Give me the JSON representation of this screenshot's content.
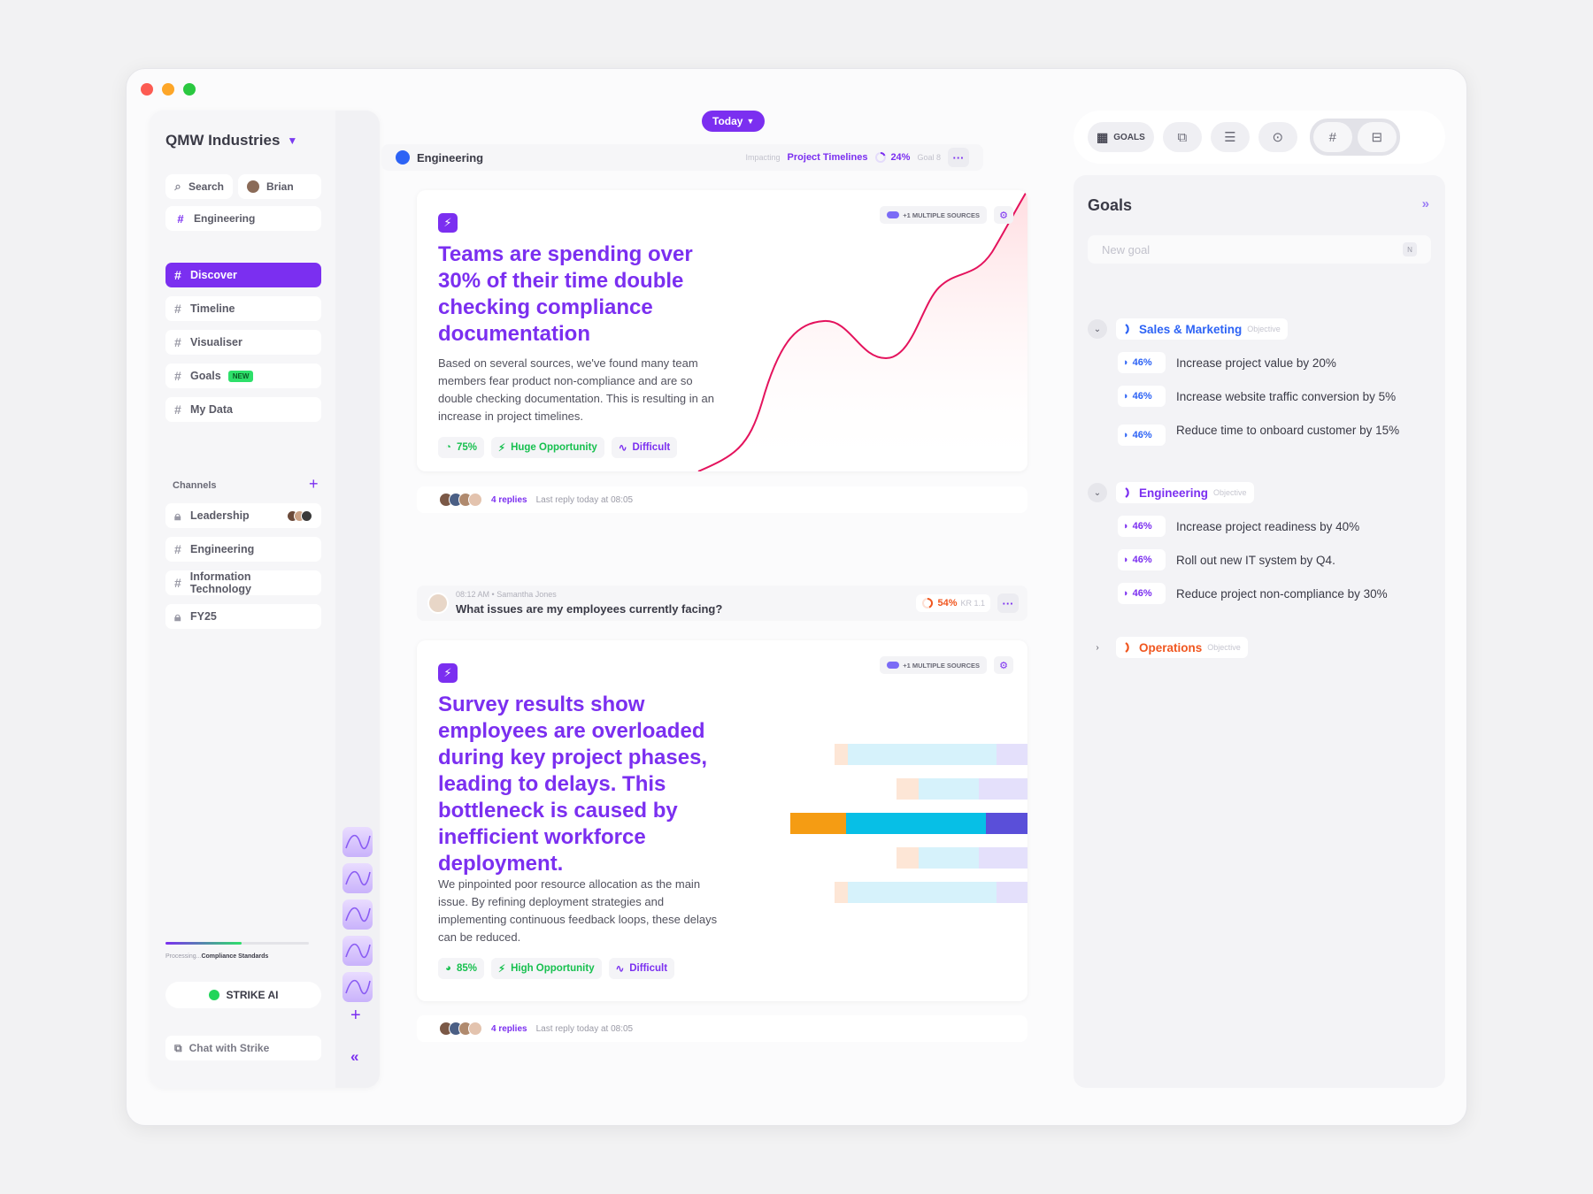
{
  "window": {
    "controls": [
      "close",
      "minimize",
      "maximize"
    ]
  },
  "sidebar": {
    "workspace": "QMW Industries",
    "search_label": "Search",
    "user_label": "Brian",
    "context_label": "Engineering",
    "nav": [
      {
        "label": "Discover",
        "active": true
      },
      {
        "label": "Timeline"
      },
      {
        "label": "Visualiser"
      },
      {
        "label": "Goals",
        "badge": "NEW"
      },
      {
        "label": "My Data"
      }
    ],
    "channels_heading": "Channels",
    "channels": [
      {
        "label": "Leadership",
        "locked": true
      },
      {
        "label": "Engineering",
        "locked": false
      },
      {
        "label": "Information Technology",
        "locked": false
      },
      {
        "label": "FY25",
        "locked": true
      }
    ],
    "processing": {
      "prefix": "Processing...",
      "label": "Compliance Standards",
      "progress": 0.53
    },
    "strike_label": "STRIKE AI",
    "chat_label": "Chat with Strike"
  },
  "center": {
    "today_label": "Today",
    "context_row": {
      "title": "Engineering",
      "impacting_label": "Impacting",
      "impacting_value": "Project Timelines",
      "percent": "24%",
      "goal_ref": "Goal 8"
    },
    "insight1": {
      "sources_label": "+1 MULTIPLE SOURCES",
      "title": "Teams are spending over 30% of their time double checking compliance documentation",
      "body": "Based on several sources, we've found many team members fear product non-compliance and are so double checking documentation. This is resulting in an increase in project timelines.",
      "confidence": "75%",
      "opportunity": "Huge Opportunity",
      "difficulty": "Difficult",
      "replies": "4 replies",
      "last_reply": "Last reply today at 08:05"
    },
    "message": {
      "time": "08:12 AM",
      "author": "Samantha Jones",
      "text": "What issues are my employees currently facing?",
      "percent": "54%",
      "kr_ref": "KR 1.1"
    },
    "insight2": {
      "sources_label": "+1 MULTIPLE SOURCES",
      "title": "Survey results show employees are overloaded during key project phases, leading to delays. This bottleneck is caused by inefficient workforce deployment.",
      "body": "We pinpointed poor resource allocation as the main issue. By refining deployment strategies and implementing continuous feedback loops, these delays can be reduced.",
      "confidence": "85%",
      "opportunity": "High Opportunity",
      "difficulty": "Difficult",
      "replies": "4 replies",
      "last_reply": "Last reply today at 08:05"
    }
  },
  "toolbar": {
    "goals_label": "GOALS"
  },
  "goals": {
    "title": "Goals",
    "new_goal_placeholder": "New goal",
    "new_goal_shortcut": "N",
    "objectives": [
      {
        "name": "Sales & Marketing",
        "type": "Objective",
        "color": "#2d63f5",
        "expanded": true,
        "krs": [
          {
            "pct": "46%",
            "text": "Increase project value by 20%"
          },
          {
            "pct": "46%",
            "text": "Increase website traffic conversion by 5%"
          },
          {
            "pct": "46%",
            "text": "Reduce time to onboard customer by 15%"
          }
        ]
      },
      {
        "name": "Engineering",
        "type": "Objective",
        "color": "#7b2ff0",
        "expanded": true,
        "krs": [
          {
            "pct": "46%",
            "text": "Increase project readiness by 40%"
          },
          {
            "pct": "46%",
            "text": "Roll out new IT system by Q4."
          },
          {
            "pct": "46%",
            "text": "Reduce project non-compliance by 30%"
          }
        ]
      },
      {
        "name": "Operations",
        "type": "Objective",
        "color": "#f0561f",
        "expanded": false,
        "krs": []
      }
    ]
  }
}
